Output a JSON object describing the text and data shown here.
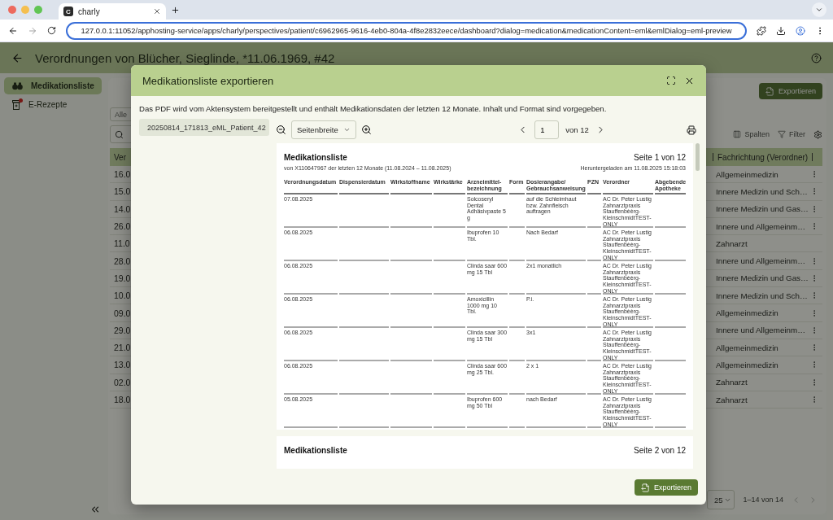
{
  "browser": {
    "tab_favicon": "C",
    "tab_title": "charly",
    "url": "127.0.0.1:11052/apphosting-service/apps/charly/perspectives/patient/c6962965-9616-4eb0-804a-4f8e2832eece/dashboard?dialog=medication&medicationContent=eml&emlDialog=eml-preview"
  },
  "app": {
    "title": "Verordnungen von Blücher, Sieglinde, *11.06.1969, #42",
    "nav": [
      {
        "label": "Medikationsliste",
        "selected": true,
        "badge": false,
        "kind": "pills"
      },
      {
        "label": "E-Rezepte",
        "selected": false,
        "badge": true,
        "kind": "bottle"
      }
    ],
    "export_button": "Exportieren",
    "filter_select": "Alle",
    "toolbar": {
      "columns": "Spalten",
      "filter": "Filter"
    },
    "table": {
      "columns": [
        "Ver",
        "Fachrichtung (Verordner)"
      ],
      "rows": [
        {
          "date": "16.0",
          "specialty": "Allgemeinmedizin",
          "menu": true
        },
        {
          "date": "15.0",
          "specialty": "Innere Medizin und Sch…",
          "menu": true
        },
        {
          "date": "14.0",
          "specialty": "Innere Medizin und Gas…",
          "menu": true
        },
        {
          "date": "26.0",
          "specialty": "Innere und Allgemeinm…",
          "menu": true
        },
        {
          "date": "11.0",
          "specialty": "Zahnarzt",
          "menu": false
        },
        {
          "date": "28.0",
          "specialty": "Innere und Allgemeinm…",
          "menu": true
        },
        {
          "date": "19.0",
          "specialty": "Innere Medizin und Gas…",
          "menu": true
        },
        {
          "date": "10.0",
          "specialty": "Innere Medizin und Sch…",
          "menu": true
        },
        {
          "date": "09.0",
          "specialty": "Allgemeinmedizin",
          "menu": true
        },
        {
          "date": "29.0",
          "specialty": "Innere und Allgemeinm…",
          "menu": true
        },
        {
          "date": "21.0",
          "specialty": "Allgemeinmedizin",
          "menu": true
        },
        {
          "date": "13.0",
          "specialty": "Allgemeinmedizin",
          "menu": true
        },
        {
          "date": "02.0",
          "specialty": "Zahnarzt",
          "menu": true
        },
        {
          "date": "18.0",
          "specialty": "Zahnarzt",
          "menu": true
        }
      ]
    },
    "pagination": {
      "page_size": "25",
      "range": "1–14 von 14"
    }
  },
  "modal": {
    "title": "Medikationsliste exportieren",
    "description": "Das PDF wird vom Aktensystem bereitgestellt und enthält Medikationsdaten der letzten 12 Monate. Inhalt und Format sind vorgegeben.",
    "attachment": "20250814_171813_eML_Patient_42",
    "viewer": {
      "zoom": "Seitenbreite",
      "page": "1",
      "page_total": "von 12"
    },
    "pages": [
      {
        "title": "Medikationsliste",
        "page_label": "Seite 1 von 12",
        "subtitle": "von X110647967 der letzten 12 Monate (11.08.2024 – 11.08.2025)",
        "downloaded": "Heruntergeladen am 11.08.2025 15:18:03",
        "columns": [
          "Verordnungsdatum",
          "Dispensierdatum",
          "Wirkstoffname",
          "Wirkstärke",
          "Arzneimittel-bezeichnung",
          "Form",
          "Dosierangabe/ Gebrauchsanweisung",
          "PZN",
          "Verordner",
          "Abgebende Apotheke"
        ],
        "rows": [
          {
            "date": "07.08.2025",
            "drug": "Solcoseryl Dental Adhäsivpaste 5 g",
            "dosage": "auf die Schleimhaut bzw. Zahnfleisch auftragen",
            "prescriber": "AC Dr. Peter Lustig Zahnarztpraxis Stauffenbèèrg-KleinschmidtTEST-ONLY"
          },
          {
            "date": "06.08.2025",
            "drug": "Ibuprofen 10 Tbl.",
            "dosage": "Nach Bedarf",
            "prescriber": "AC Dr. Peter Lustig Zahnarztpraxis Stauffenbèèrg-KleinschmidtTEST-ONLY"
          },
          {
            "date": "06.08.2025",
            "drug": "Clinda saar 600 mg 15 Tbl",
            "dosage": "2x1 monatlich",
            "prescriber": "AC Dr. Peter Lustig Zahnarztpraxis Stauffenbèèrg-KleinschmidtTEST-ONLY"
          },
          {
            "date": "06.08.2025",
            "drug": "Amoxicillin 1000 mg 10 Tbl.",
            "dosage": "P.i.",
            "prescriber": "AC Dr. Peter Lustig Zahnarztpraxis Stauffenbèèrg-KleinschmidtTEST-ONLY"
          },
          {
            "date": "06.08.2025",
            "drug": "Clinda saar 300 mg 15 Tbl",
            "dosage": "3x1",
            "prescriber": "AC Dr. Peter Lustig Zahnarztpraxis Stauffenbèèrg-KleinschmidtTEST-ONLY"
          },
          {
            "date": "06.08.2025",
            "drug": "Clinda saar 600 mg 25 Tbl.",
            "dosage": "2 x 1",
            "prescriber": "AC Dr. Peter Lustig Zahnarztpraxis Stauffenbèèrg-KleinschmidtTEST-ONLY"
          },
          {
            "date": "05.08.2025",
            "drug": "Ibuprofen 600 mg 50 Tbl",
            "dosage": "nach Bedarf",
            "prescriber": "AC Dr. Peter Lustig Zahnarztpraxis Stauffenbèèrg-KleinschmidtTEST-ONLY"
          }
        ]
      },
      {
        "title": "Medikationsliste",
        "page_label": "Seite 2 von 12"
      }
    ],
    "export_button": "Exportieren"
  }
}
